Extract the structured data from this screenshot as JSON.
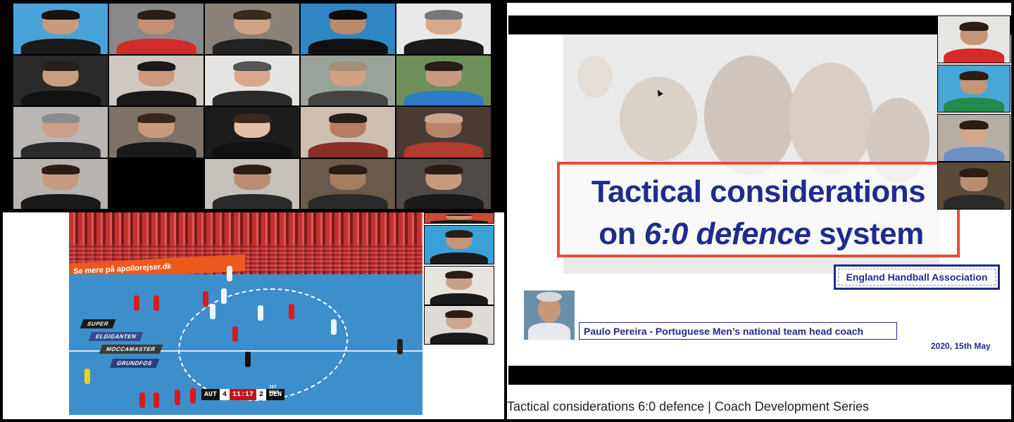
{
  "colors": {
    "slide_title_blue": "#1f2b8c",
    "slide_border_red": "#e94d33",
    "court_blue": "#3d8fcc",
    "stands_red": "#c23230"
  },
  "meeting_grid": {
    "participants": [
      {
        "bg": "#4aa3d8",
        "shirt": "#1a1a1a",
        "skin": "#c99b7e",
        "hair": "#1a120c"
      },
      {
        "bg": "#888888",
        "shirt": "#d42a2a",
        "skin": "#c48f72",
        "hair": "#2a1d15"
      },
      {
        "bg": "#8a8278",
        "shirt": "#222222",
        "skin": "#d0a285",
        "hair": "#3a2a1c"
      },
      {
        "bg": "#2f86c2",
        "shirt": "#111111",
        "skin": "#b98a6e",
        "hair": "#0e0a08"
      },
      {
        "bg": "#e8e8e8",
        "shirt": "#1a1a1a",
        "skin": "#d6a88c",
        "hair": "#777777"
      },
      {
        "bg": "#2a2a2a",
        "shirt": "#111111",
        "skin": "#c79f83",
        "hair": "#2a1d15"
      },
      {
        "bg": "#cfc9c2",
        "shirt": "#1a1a1a",
        "skin": "#cc9a7a",
        "hair": "#1a1a1a"
      },
      {
        "bg": "#e6e4e2",
        "shirt": "#2a2a2a",
        "skin": "#d6a98f",
        "hair": "#555555"
      },
      {
        "bg": "#9aa39a",
        "shirt": "#444444",
        "skin": "#d0a081",
        "hair": "#a58d76"
      },
      {
        "bg": "#6d8f5a",
        "shirt": "#2a7bc8",
        "skin": "#c99880",
        "hair": "#2a1d15"
      },
      {
        "bg": "#b9b6b3",
        "shirt": "#2a2a2a",
        "skin": "#c9a08a",
        "hair": "#8c8c8c"
      },
      {
        "bg": "#7d7268",
        "shirt": "#1a1a1a",
        "skin": "#c89a7c",
        "hair": "#3a2418"
      },
      {
        "bg": "#1c1c1c",
        "shirt": "#111111",
        "skin": "#e3c0a6",
        "hair": "#3a2a1c"
      },
      {
        "bg": "#cdbfb0",
        "shirt": "#8a2e26",
        "skin": "#b57d62",
        "hair": "#2a1d15"
      },
      {
        "bg": "#4a3a34",
        "shirt": "#b23a2e",
        "skin": "#b68468",
        "hair": "#cfa48c"
      },
      {
        "bg": "#b7b3ae",
        "shirt": "#1a1a1a",
        "skin": "#c69a80",
        "hair": "#2a1d15"
      },
      {
        "bg": "#000000",
        "shirt": "#000000",
        "skin": "#000000",
        "hair": "#000000"
      },
      {
        "bg": "#c5c0ba",
        "shirt": "#2a2a2a",
        "skin": "#b88d72",
        "hair": "#2a1d15"
      },
      {
        "bg": "#6a5a4c",
        "shirt": "#2a2a2a",
        "skin": "#a77e62",
        "hair": "#2a1d15"
      },
      {
        "bg": "#4f4a46",
        "shirt": "#1a1a1a",
        "skin": "#c89a7c",
        "hair": "#2a1d15"
      }
    ]
  },
  "video": {
    "ad_banner": "Se mere på apollorejser.dk",
    "court_ads": [
      "SUPER",
      "ELGIGANTEN",
      "MOCCAMASTER",
      "GRUNDFOS"
    ],
    "scorebug": {
      "home_team": "AUT",
      "home_score": "4",
      "clock": "11:17",
      "period": "1ST HALF",
      "away_score": "2",
      "away_team": "DEN"
    }
  },
  "side_participants": [
    {
      "bg": "#c94a36",
      "skin": "#c59274"
    },
    {
      "bg": "#3aa0d8",
      "skin": "#c49478"
    },
    {
      "bg": "#e7e3de",
      "skin": "#c9a086"
    },
    {
      "bg": "#dedad5",
      "skin": "#cfa48c"
    }
  ],
  "presentation": {
    "title_line1": "Tactical considerations",
    "title_line2_pre": "on ",
    "title_line2_italic": "6:0 defence",
    "title_line2_post": " system",
    "association": "England Handball Association",
    "presenter": "Paulo Pereira - Portuguese Men’s national team head coach",
    "date": "2020, 15th May"
  },
  "presentation_thumbs": [
    {
      "bg": "#e8e6e3",
      "shirt": "#d42a2a",
      "skin": "#c89478"
    },
    {
      "bg": "#48a6d8",
      "shirt": "#1f8a4a",
      "skin": "#c39478"
    },
    {
      "bg": "#b6aea4",
      "shirt": "#6c8fc4",
      "skin": "#d2a688"
    },
    {
      "bg": "#5a4a3a",
      "shirt": "#2a2a2a",
      "skin": "#b98c70"
    }
  ],
  "video_title": "Tactical considerations 6:0 defence | Coach Development Series"
}
